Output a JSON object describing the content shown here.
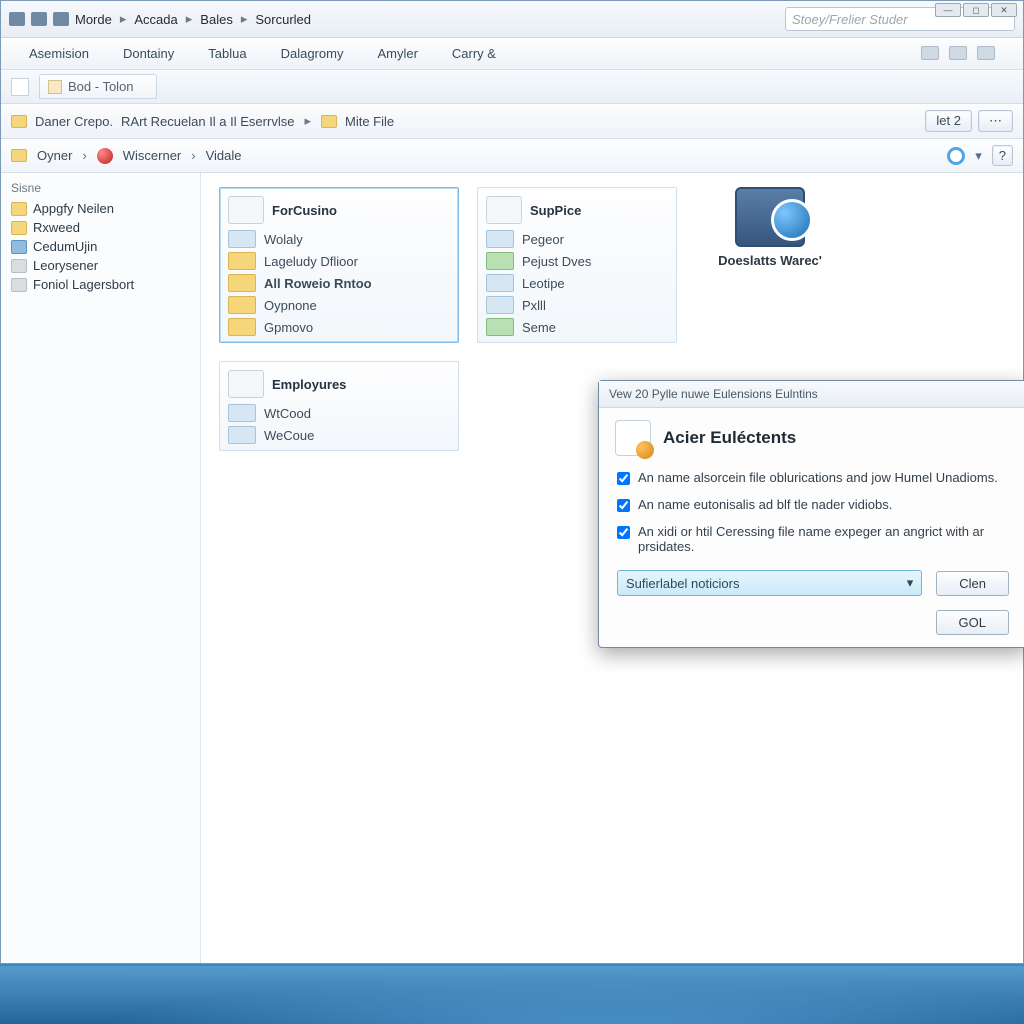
{
  "breadcrumb": {
    "seg1": "Morde",
    "seg2": "Accada",
    "seg3": "Bales",
    "seg4": "Sorcurled"
  },
  "search": {
    "placeholder": "Stoey/Frelier Studer"
  },
  "menu": {
    "m1": "Asemision",
    "m2": "Dontainy",
    "m3": "Tablua",
    "m4": "Dalagromy",
    "m5": "Amyler",
    "m6": "Carry &"
  },
  "tab": {
    "label": "Bod - Tolon"
  },
  "path1": {
    "p1": "Daner Crepo.",
    "p2": "RArt Recuelan Il a Il Eserrvlse",
    "p3": "Mite File",
    "btn": "let 2"
  },
  "path2": {
    "a": "Oyner",
    "b": "Wiscerner",
    "c": "Vidale"
  },
  "sidebar": {
    "head": "Sisne",
    "items": [
      {
        "label": "Appgfy Neilen"
      },
      {
        "label": "Rxweed"
      },
      {
        "label": "CedumUjin"
      },
      {
        "label": "Leorysener"
      },
      {
        "label": "Foniol Lagersbort"
      }
    ]
  },
  "tiles": {
    "t1": {
      "title": "ForCusino",
      "r1": "Wolaly",
      "r2": "Lageludy Dflioor",
      "r3": "All Roweio Rntoo",
      "r4": "Oypnone",
      "r5": "Gpmovo"
    },
    "t2": {
      "title": "SupPice",
      "r1": "Pegeor",
      "r2": "Pejust Dves",
      "r3": "Leotipe",
      "r4": "Pxlll",
      "r5": "Seme"
    },
    "t3": {
      "title": "Employures",
      "r1": "WtCood",
      "r2": "WeCoue"
    },
    "big": {
      "caption": "Doeslatts Warec'"
    }
  },
  "dialog": {
    "titlebar": "Vew 20 Pylle nuwe Eulensions Eulntins",
    "heading": "Acier Euléctents",
    "opt1": "An name alsorcein file oblurications and jow Humel Unadioms.",
    "opt2": "An name eutonisalis ad blf tle nader vidiobs.",
    "opt3": "An xidi or htil Ceressing file name expeger an angrict with ar prsidates.",
    "combo": "Sufierlabel noticiors",
    "btn_clear": "Clen",
    "btn_gol": "GOL"
  }
}
